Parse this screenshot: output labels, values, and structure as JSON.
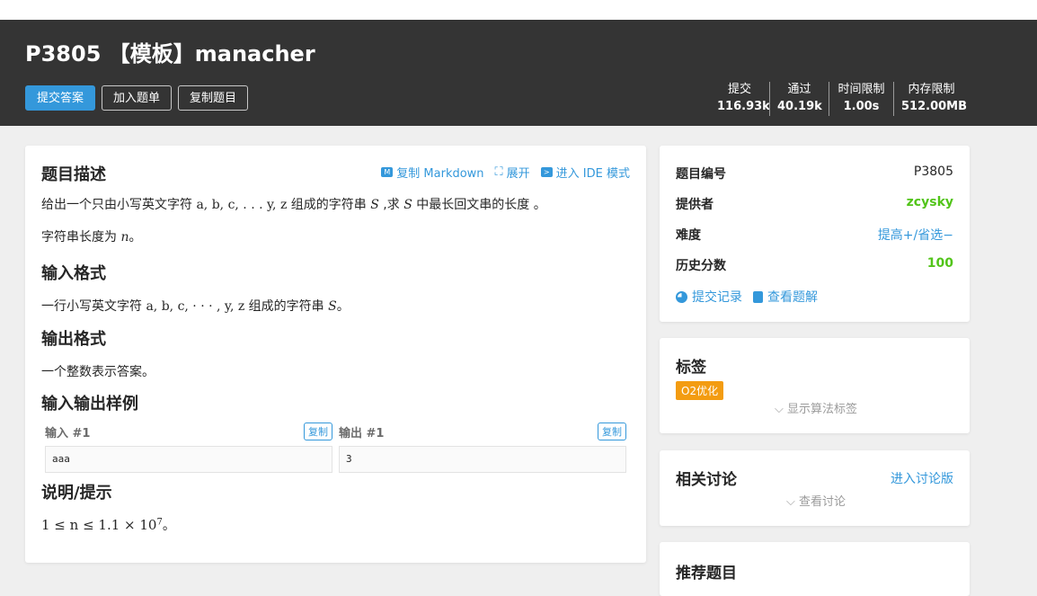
{
  "header": {
    "title": "P3805 【模板】manacher",
    "buttons": {
      "submit": "提交答案",
      "add": "加入题单",
      "copy": "复制题目"
    },
    "stats": [
      {
        "label": "提交",
        "value": "116.93k"
      },
      {
        "label": "通过",
        "value": "40.19k"
      },
      {
        "label": "时间限制",
        "value": "1.00s"
      },
      {
        "label": "内存限制",
        "value": "512.00MB"
      }
    ]
  },
  "main": {
    "tools": {
      "copy_md": "复制 Markdown",
      "expand": "展开",
      "ide": "进入 IDE 模式"
    },
    "desc_title": "题目描述",
    "desc_p1_pre": "给出一个只由小写英文字符 ",
    "desc_p1_chars": "a, b, c, . . . y, z",
    "desc_p1_mid": " 组成的字符串 ",
    "desc_p1_S": "S",
    "desc_p1_mid2": " ,求 ",
    "desc_p1_S2": "S",
    "desc_p1_post": " 中最长回文串的长度 。",
    "desc_p2_pre": "字符串长度为 ",
    "desc_p2_n": "n",
    "desc_p2_post": "。",
    "input_title": "输入格式",
    "input_pre": "一行小写英文字符 ",
    "input_chars": "a, b, c, · · · , y, z",
    "input_mid": " 组成的字符串 ",
    "input_S": "S",
    "input_post": "。",
    "output_title": "输出格式",
    "output_text": "一个整数表示答案。",
    "samples_title": "输入输出样例",
    "sample_in_label": "输入 #1",
    "sample_out_label": "输出 #1",
    "copy_label": "复制",
    "sample_in": "aaa",
    "sample_out": "3",
    "hint_title": "说明/提示",
    "hint_math": "1 ≤ n ≤ 1.1 × 10",
    "hint_exp": "7",
    "hint_post": "。"
  },
  "side": {
    "rows": [
      {
        "label": "题目编号",
        "value": "P3805"
      },
      {
        "label": "提供者",
        "value": "zcysky"
      },
      {
        "label": "难度",
        "value": "提高+/省选−"
      },
      {
        "label": "历史分数",
        "value": "100"
      }
    ],
    "links": {
      "records": "提交记录",
      "solutions": "查看题解"
    },
    "tags_title": "标签",
    "tag": "O2优化",
    "show_tags": "⌵ 显示算法标签",
    "discuss_title": "相关讨论",
    "discuss_link": "进入讨论版",
    "view_discuss": "⌵ 查看讨论",
    "recommend_title": "推荐题目"
  },
  "colors": {
    "accent": "#3498db",
    "green": "#52c41a",
    "tag": "#f39c11",
    "header_bg": "#343434"
  }
}
